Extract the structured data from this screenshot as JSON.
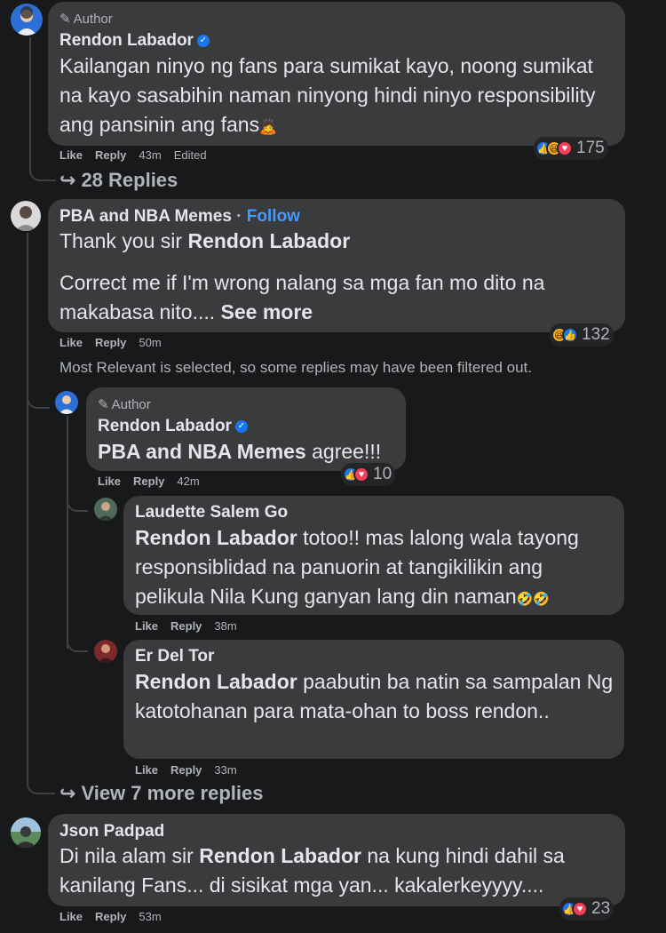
{
  "actions": {
    "like": "Like",
    "reply": "Reply",
    "edited": "Edited"
  },
  "author_badge": "Author",
  "comments": [
    {
      "name": "Rendon Labador",
      "text": "Kailangan ninyo ng fans para sumikat kayo, noong sumikat na kayo sasabihin naman ninyong hindi ninyo responsibility ang pansinin ang fans",
      "emoji": "🙇",
      "time": "43m",
      "reactions": "175",
      "replies_link": "28 Replies"
    },
    {
      "name": "PBA and NBA Memes",
      "follow": "Follow",
      "line1_prefix": "Thank you sir ",
      "line1_mention": "Rendon Labador",
      "line2": "Correct me if I'm wrong nalang sa mga fan mo dito na makabasa nito....",
      "see_more": "See more",
      "time": "50m",
      "reactions": "132",
      "filter_note": "Most Relevant is selected, so some replies may have been filtered out."
    },
    {
      "name": "Rendon Labador",
      "mention": "PBA and NBA Memes",
      "text": " agree!!!",
      "time": "42m",
      "reactions": "10"
    },
    {
      "name": "Laudette Salem Go",
      "mention": "Rendon Labador",
      "text": " totoo!! mas lalong wala tayong responsiblidad na panuorin at tangikilikin ang pelikula Nila Kung ganyan lang din naman",
      "emoji": "🤣🤣",
      "time": "38m"
    },
    {
      "name": "Er Del Tor",
      "mention": "Rendon Labador",
      "text": " paabutin ba natin sa sampalan Ng katotohanan para mata-ohan to boss rendon..",
      "time": "33m",
      "more_replies": "View 7 more replies"
    },
    {
      "name": "Json Padpad",
      "prefix": "Di nila alam sir ",
      "mention": "Rendon Labador",
      "text": " na kung hindi dahil sa kanilang Fans... di sisikat mga yan... kakalerkeyyyy....",
      "time": "53m",
      "reactions": "23"
    }
  ],
  "colors": {
    "background": "#18191a",
    "bubble": "#3a3b3c",
    "text": "#e4e6eb",
    "muted": "#b0b3b8",
    "link": "#4599ff",
    "like": "#1877f2",
    "love": "#f33e58",
    "haha": "#f7b125"
  }
}
